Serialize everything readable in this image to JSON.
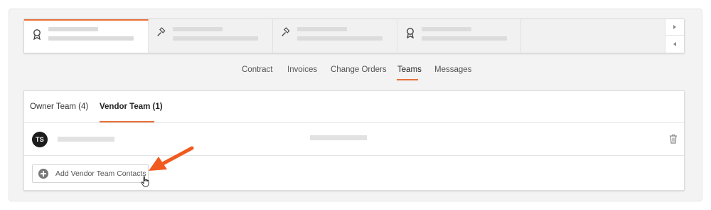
{
  "nav": {
    "tabs": [
      {
        "label": "Contract"
      },
      {
        "label": "Invoices"
      },
      {
        "label": "Change Orders"
      },
      {
        "label": "Teams"
      },
      {
        "label": "Messages"
      }
    ],
    "active_tab": "Teams"
  },
  "cards": [
    {
      "icon": "award-ribbon-icon",
      "active": true
    },
    {
      "icon": "gavel-icon",
      "active": false
    },
    {
      "icon": "gavel-icon",
      "active": false
    },
    {
      "icon": "award-ribbon-icon",
      "active": false
    }
  ],
  "teams": {
    "subtabs": [
      {
        "label": "Owner Team (4)"
      },
      {
        "label": "Vendor Team (1)"
      }
    ],
    "active_subtab": "Vendor Team (1)",
    "members": [
      {
        "initials": "TS"
      }
    ],
    "add_button_label": "Add Vendor Team Contacts"
  },
  "colors": {
    "accent": "#e8703a",
    "annotation_arrow": "#f05a1e",
    "avatar_bg": "#1c1c1c"
  }
}
